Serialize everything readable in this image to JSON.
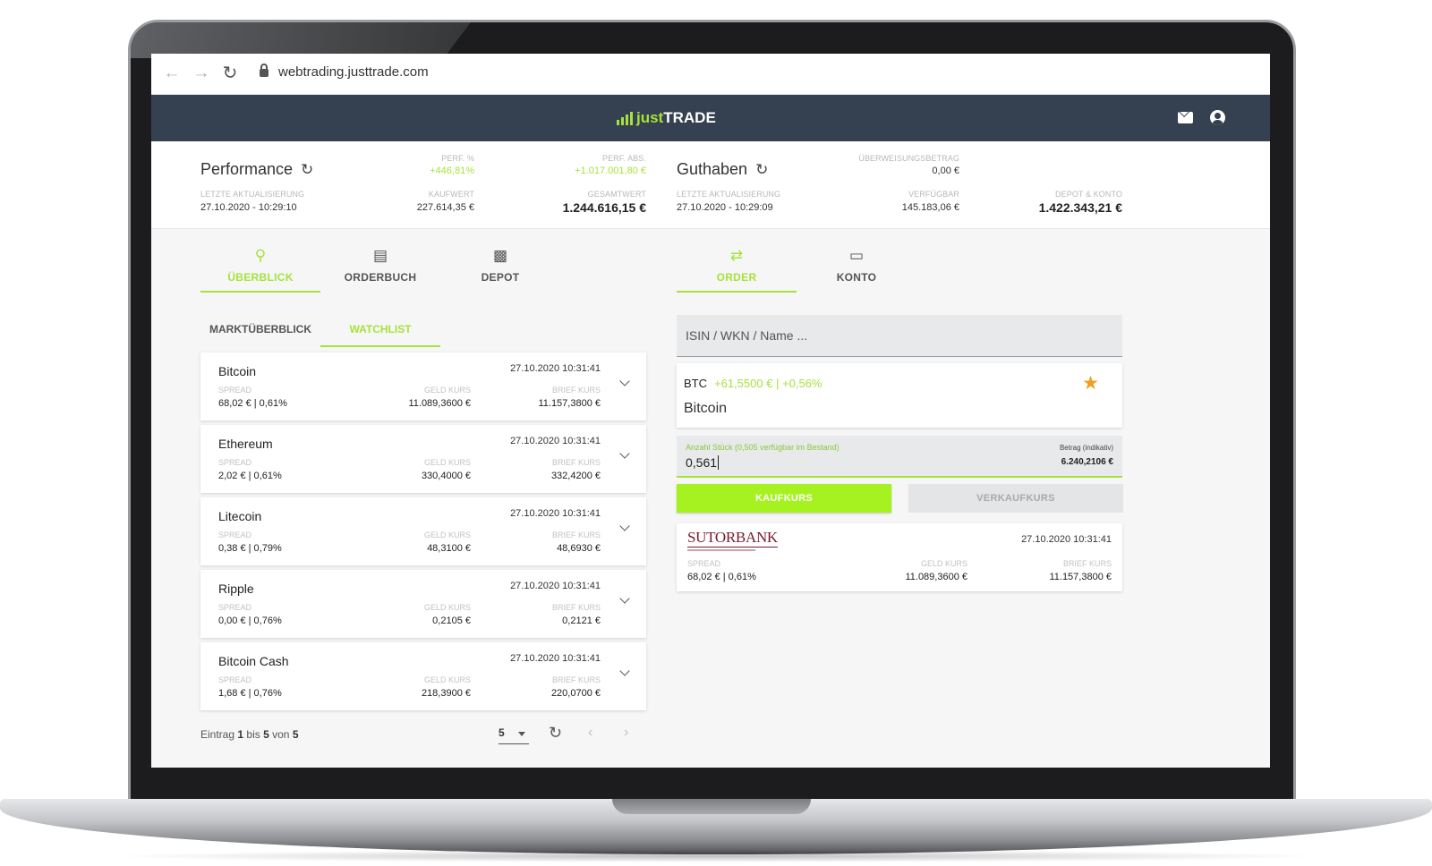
{
  "browser": {
    "url": "webtrading.justtrade.com"
  },
  "header": {
    "logo_just": "just",
    "logo_trade": "TRADE"
  },
  "performance": {
    "title": "Performance",
    "last_update_label": "LETZTE AKTUALISIERUNG",
    "last_update": "27.10.2020 - 10:29:10",
    "perf_pct_label": "PERF. %",
    "perf_pct": "+446,81%",
    "perf_abs_label": "PERF. ABS.",
    "perf_abs": "+1.017.001,80 €",
    "kaufwert_label": "KAUFWERT",
    "kaufwert": "227.614,35 €",
    "gesamtwert_label": "GESAMTWERT",
    "gesamtwert": "1.244.616,15 €"
  },
  "guthaben": {
    "title": "Guthaben",
    "last_update_label": "LETZTE AKTUALISIERUNG",
    "last_update": "27.10.2020 - 10:29:09",
    "ueberweisung_label": "ÜBERWEISUNGSBETRAG",
    "ueberweisung": "0,00 €",
    "verfuegbar_label": "VERFÜGBAR",
    "verfuegbar": "145.183,06 €",
    "depot_konto_label": "DEPOT & KONTO",
    "depot_konto": "1.422.343,21 €"
  },
  "tabs_left": [
    {
      "label": "ÜBERBLICK",
      "active": true
    },
    {
      "label": "ORDERBUCH",
      "active": false
    },
    {
      "label": "DEPOT",
      "active": false
    }
  ],
  "tabs_right": [
    {
      "label": "ORDER",
      "active": true
    },
    {
      "label": "KONTO",
      "active": false
    }
  ],
  "subtabs": [
    {
      "label": "MARKTÜBERBLICK",
      "active": false
    },
    {
      "label": "WATCHLIST",
      "active": true
    }
  ],
  "coin_labels": {
    "spread": "SPREAD",
    "geld": "GELD KURS",
    "brief": "BRIEF KURS"
  },
  "coins": [
    {
      "name": "Bitcoin",
      "time": "27.10.2020 10:31:41",
      "spread": "68,02 € | 0,61%",
      "geld": "11.089,3600 €",
      "brief": "11.157,3800 €"
    },
    {
      "name": "Ethereum",
      "time": "27.10.2020 10:31:41",
      "spread": "2,02 € | 0,61%",
      "geld": "330,4000 €",
      "brief": "332,4200 €"
    },
    {
      "name": "Litecoin",
      "time": "27.10.2020 10:31:41",
      "spread": "0,38 € | 0,79%",
      "geld": "48,3100 €",
      "brief": "48,6930 €"
    },
    {
      "name": "Ripple",
      "time": "27.10.2020 10:31:41",
      "spread": "0,00 € | 0,76%",
      "geld": "0,2105 €",
      "brief": "0,2121 €"
    },
    {
      "name": "Bitcoin Cash",
      "time": "27.10.2020 10:31:41",
      "spread": "1,68 € | 0,76%",
      "geld": "218,3900 €",
      "brief": "220,0700 €"
    }
  ],
  "pager": {
    "prefix": "Eintrag",
    "from": "1",
    "mid": "bis",
    "to": "5",
    "of": "von",
    "total": "5",
    "page_size": "5"
  },
  "order": {
    "search_placeholder": "ISIN / WKN / Name ...",
    "symbol": "BTC",
    "change": "+61,5500 € | +0,56%",
    "asset_name": "Bitcoin",
    "qty_label": "Anzahl Stück (0,505 verfügbar im Bestand)",
    "qty_value": "0,561",
    "amount_label": "Betrag (indikativ)",
    "amount_value": "6.240,2106 €",
    "buy_label": "KAUFKURS",
    "sell_label": "VERKAUFKURS"
  },
  "bank": {
    "logo": "SUTORBANK",
    "time": "27.10.2020 10:31:41",
    "spread": "68,02 € | 0,61%",
    "geld": "11.089,3600 €",
    "brief": "11.157,3800 €"
  },
  "colors": {
    "accent": "#a6e23b",
    "header_bg": "#354050",
    "star": "#f39c1f",
    "bank": "#7a1a2c"
  }
}
